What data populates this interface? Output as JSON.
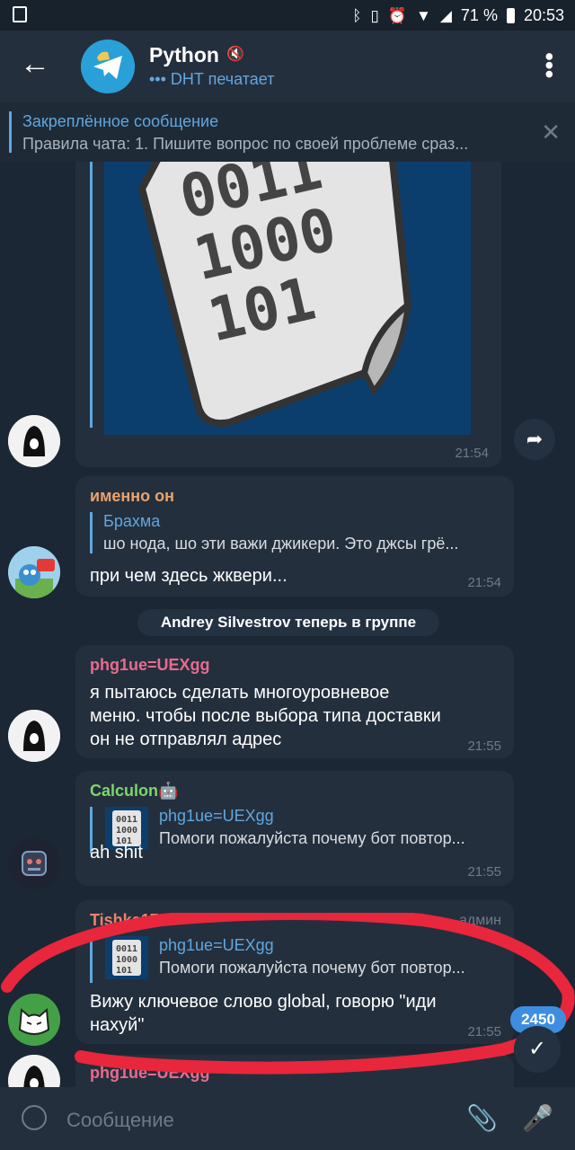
{
  "status_bar": {
    "battery_percent": "71 %",
    "clock": "20:53"
  },
  "header": {
    "back_icon": "arrow-left-icon",
    "title": "Python",
    "subtitle": "••• DHT печатает",
    "menu_icon": "more-vertical-icon"
  },
  "pinned": {
    "title": "Закреплённое сообщение",
    "text": "Правила чата: 1. Пишите вопрос по своей проблеме сраз..."
  },
  "messages": [
    {
      "type": "image",
      "time": "21:54",
      "image_numbers": [
        "0011",
        "1000",
        "101"
      ]
    },
    {
      "sender": "именно он",
      "sender_color": "#e8a36b",
      "reply_name": "Брахма",
      "reply_text": "шо нода, шо эти важи джикери. Это джсы грё...",
      "text": "при чем здесь жквери...",
      "time": "21:54"
    },
    {
      "type": "service",
      "text": "Andrey Silvestrov теперь в группе"
    },
    {
      "sender": "phg1ue=UEXgg",
      "sender_color": "#e86b8d",
      "text_lines": [
        "я пытаюсь сделать многоуровневое",
        "меню. чтобы после выбора типа доставки",
        "он не отправлял адрес"
      ],
      "time": "21:55"
    },
    {
      "sender": "Calculon🤖",
      "sender_color": "#7cd66b",
      "reply_name": "phg1ue=UEXgg",
      "reply_text": "Помоги пожалуйста почему бот повтор...",
      "text": "ah shit",
      "time": "21:55"
    },
    {
      "sender": "Tishka17",
      "sender_color": "#e8836b",
      "role": "админ",
      "reply_name": "phg1ue=UEXgg",
      "reply_text": "Помоги пожалуйста почему бот повтор...",
      "text_lines": [
        "Вижу ключевое слово global, говорю \"иди",
        "нахуй\""
      ],
      "time": "21:55"
    },
    {
      "sender": "phg1ue=UEXgg",
      "sender_color": "#e86b8d"
    }
  ],
  "unread_badge": "2450",
  "input": {
    "placeholder": "Сообщение"
  },
  "colors": {
    "accent": "#5fa7e0",
    "background": "#1b2734",
    "bubble": "#242f3d",
    "annotation": "#e8263c"
  }
}
